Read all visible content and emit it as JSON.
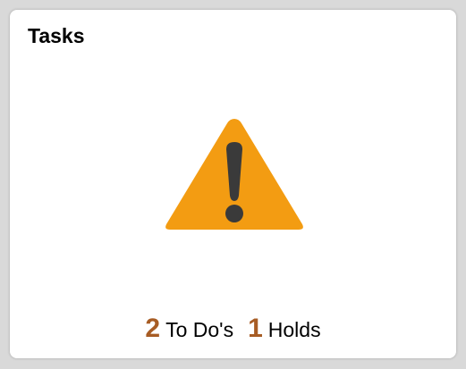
{
  "tile": {
    "title": "Tasks",
    "icon": "warning-icon",
    "todo_count": "2",
    "todo_label": "To Do's",
    "holds_count": "1",
    "holds_label": "Holds"
  },
  "colors": {
    "warning": "#f39c12",
    "warning_mark": "#3a3a3a",
    "count": "#a75c24"
  }
}
